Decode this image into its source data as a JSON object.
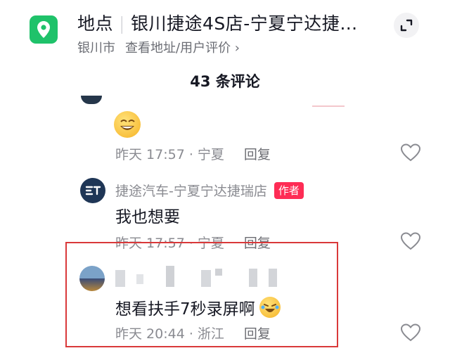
{
  "header": {
    "title": "地点",
    "place": "银川捷途4S店-宁夏宁达捷…",
    "city": "银川市",
    "sub_link": "查看地址/用户评价 ›"
  },
  "comments_header": {
    "count_label": "43 条评论"
  },
  "comments": [
    {
      "time_loc": "昨天 17:57 · 宁夏",
      "reply": "回复"
    },
    {
      "author": "捷途汽车-宁夏宁达捷瑞店",
      "badge": "作者",
      "text": "我也想要",
      "time_loc": "昨天 17:57 · 宁夏",
      "reply": "回复"
    },
    {
      "text": "想看扶手7秒录屏啊",
      "time_loc": "昨天 20:44 · 浙江",
      "reply": "回复"
    }
  ],
  "icons": {
    "location": "map-pin-icon",
    "expand": "expand-icon",
    "like": "heart-outline-icon",
    "emoji": "grinning-emoji-icon",
    "laugh": "laughing-emoji-icon"
  },
  "colors": {
    "accent": "#fe2c55",
    "location_green": "#1fc26a",
    "highlight": "#d9393a"
  }
}
